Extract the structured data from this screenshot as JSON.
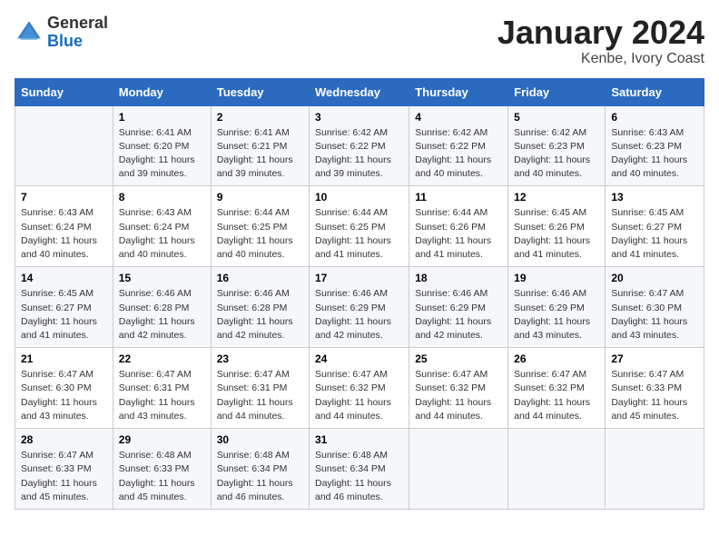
{
  "header": {
    "logo_general": "General",
    "logo_blue": "Blue",
    "month_title": "January 2024",
    "location": "Kenbe, Ivory Coast"
  },
  "days_of_week": [
    "Sunday",
    "Monday",
    "Tuesday",
    "Wednesday",
    "Thursday",
    "Friday",
    "Saturday"
  ],
  "weeks": [
    [
      {
        "day": "",
        "sunrise": "",
        "sunset": "",
        "daylight": ""
      },
      {
        "day": "1",
        "sunrise": "Sunrise: 6:41 AM",
        "sunset": "Sunset: 6:20 PM",
        "daylight": "Daylight: 11 hours and 39 minutes."
      },
      {
        "day": "2",
        "sunrise": "Sunrise: 6:41 AM",
        "sunset": "Sunset: 6:21 PM",
        "daylight": "Daylight: 11 hours and 39 minutes."
      },
      {
        "day": "3",
        "sunrise": "Sunrise: 6:42 AM",
        "sunset": "Sunset: 6:22 PM",
        "daylight": "Daylight: 11 hours and 39 minutes."
      },
      {
        "day": "4",
        "sunrise": "Sunrise: 6:42 AM",
        "sunset": "Sunset: 6:22 PM",
        "daylight": "Daylight: 11 hours and 40 minutes."
      },
      {
        "day": "5",
        "sunrise": "Sunrise: 6:42 AM",
        "sunset": "Sunset: 6:23 PM",
        "daylight": "Daylight: 11 hours and 40 minutes."
      },
      {
        "day": "6",
        "sunrise": "Sunrise: 6:43 AM",
        "sunset": "Sunset: 6:23 PM",
        "daylight": "Daylight: 11 hours and 40 minutes."
      }
    ],
    [
      {
        "day": "7",
        "sunrise": "Sunrise: 6:43 AM",
        "sunset": "Sunset: 6:24 PM",
        "daylight": "Daylight: 11 hours and 40 minutes."
      },
      {
        "day": "8",
        "sunrise": "Sunrise: 6:43 AM",
        "sunset": "Sunset: 6:24 PM",
        "daylight": "Daylight: 11 hours and 40 minutes."
      },
      {
        "day": "9",
        "sunrise": "Sunrise: 6:44 AM",
        "sunset": "Sunset: 6:25 PM",
        "daylight": "Daylight: 11 hours and 40 minutes."
      },
      {
        "day": "10",
        "sunrise": "Sunrise: 6:44 AM",
        "sunset": "Sunset: 6:25 PM",
        "daylight": "Daylight: 11 hours and 41 minutes."
      },
      {
        "day": "11",
        "sunrise": "Sunrise: 6:44 AM",
        "sunset": "Sunset: 6:26 PM",
        "daylight": "Daylight: 11 hours and 41 minutes."
      },
      {
        "day": "12",
        "sunrise": "Sunrise: 6:45 AM",
        "sunset": "Sunset: 6:26 PM",
        "daylight": "Daylight: 11 hours and 41 minutes."
      },
      {
        "day": "13",
        "sunrise": "Sunrise: 6:45 AM",
        "sunset": "Sunset: 6:27 PM",
        "daylight": "Daylight: 11 hours and 41 minutes."
      }
    ],
    [
      {
        "day": "14",
        "sunrise": "Sunrise: 6:45 AM",
        "sunset": "Sunset: 6:27 PM",
        "daylight": "Daylight: 11 hours and 41 minutes."
      },
      {
        "day": "15",
        "sunrise": "Sunrise: 6:46 AM",
        "sunset": "Sunset: 6:28 PM",
        "daylight": "Daylight: 11 hours and 42 minutes."
      },
      {
        "day": "16",
        "sunrise": "Sunrise: 6:46 AM",
        "sunset": "Sunset: 6:28 PM",
        "daylight": "Daylight: 11 hours and 42 minutes."
      },
      {
        "day": "17",
        "sunrise": "Sunrise: 6:46 AM",
        "sunset": "Sunset: 6:29 PM",
        "daylight": "Daylight: 11 hours and 42 minutes."
      },
      {
        "day": "18",
        "sunrise": "Sunrise: 6:46 AM",
        "sunset": "Sunset: 6:29 PM",
        "daylight": "Daylight: 11 hours and 42 minutes."
      },
      {
        "day": "19",
        "sunrise": "Sunrise: 6:46 AM",
        "sunset": "Sunset: 6:29 PM",
        "daylight": "Daylight: 11 hours and 43 minutes."
      },
      {
        "day": "20",
        "sunrise": "Sunrise: 6:47 AM",
        "sunset": "Sunset: 6:30 PM",
        "daylight": "Daylight: 11 hours and 43 minutes."
      }
    ],
    [
      {
        "day": "21",
        "sunrise": "Sunrise: 6:47 AM",
        "sunset": "Sunset: 6:30 PM",
        "daylight": "Daylight: 11 hours and 43 minutes."
      },
      {
        "day": "22",
        "sunrise": "Sunrise: 6:47 AM",
        "sunset": "Sunset: 6:31 PM",
        "daylight": "Daylight: 11 hours and 43 minutes."
      },
      {
        "day": "23",
        "sunrise": "Sunrise: 6:47 AM",
        "sunset": "Sunset: 6:31 PM",
        "daylight": "Daylight: 11 hours and 44 minutes."
      },
      {
        "day": "24",
        "sunrise": "Sunrise: 6:47 AM",
        "sunset": "Sunset: 6:32 PM",
        "daylight": "Daylight: 11 hours and 44 minutes."
      },
      {
        "day": "25",
        "sunrise": "Sunrise: 6:47 AM",
        "sunset": "Sunset: 6:32 PM",
        "daylight": "Daylight: 11 hours and 44 minutes."
      },
      {
        "day": "26",
        "sunrise": "Sunrise: 6:47 AM",
        "sunset": "Sunset: 6:32 PM",
        "daylight": "Daylight: 11 hours and 44 minutes."
      },
      {
        "day": "27",
        "sunrise": "Sunrise: 6:47 AM",
        "sunset": "Sunset: 6:33 PM",
        "daylight": "Daylight: 11 hours and 45 minutes."
      }
    ],
    [
      {
        "day": "28",
        "sunrise": "Sunrise: 6:47 AM",
        "sunset": "Sunset: 6:33 PM",
        "daylight": "Daylight: 11 hours and 45 minutes."
      },
      {
        "day": "29",
        "sunrise": "Sunrise: 6:48 AM",
        "sunset": "Sunset: 6:33 PM",
        "daylight": "Daylight: 11 hours and 45 minutes."
      },
      {
        "day": "30",
        "sunrise": "Sunrise: 6:48 AM",
        "sunset": "Sunset: 6:34 PM",
        "daylight": "Daylight: 11 hours and 46 minutes."
      },
      {
        "day": "31",
        "sunrise": "Sunrise: 6:48 AM",
        "sunset": "Sunset: 6:34 PM",
        "daylight": "Daylight: 11 hours and 46 minutes."
      },
      {
        "day": "",
        "sunrise": "",
        "sunset": "",
        "daylight": ""
      },
      {
        "day": "",
        "sunrise": "",
        "sunset": "",
        "daylight": ""
      },
      {
        "day": "",
        "sunrise": "",
        "sunset": "",
        "daylight": ""
      }
    ]
  ]
}
